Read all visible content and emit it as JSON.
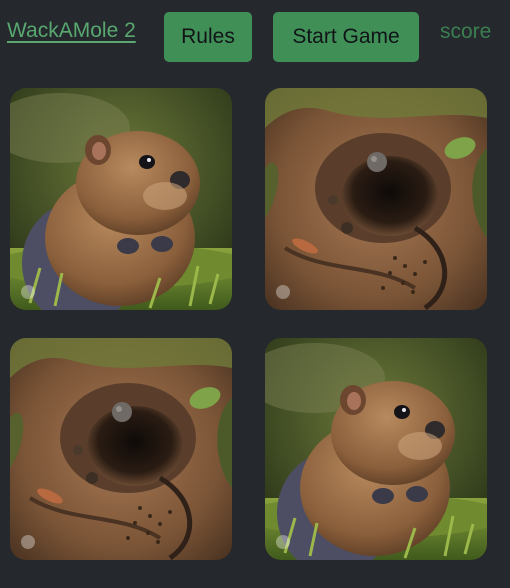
{
  "header": {
    "title": "WackAMole 2",
    "rules_label": "Rules",
    "start_label": "Start Game",
    "score_label": "score"
  },
  "board": {
    "tiles": [
      {
        "state": "mole",
        "image": "mole-in-grass"
      },
      {
        "state": "empty",
        "image": "dirt-hole"
      },
      {
        "state": "empty",
        "image": "dirt-hole"
      },
      {
        "state": "mole",
        "image": "mole-in-grass"
      }
    ]
  },
  "colors": {
    "background": "#25282d",
    "accent": "#3f8f56",
    "link": "#58a86f"
  }
}
